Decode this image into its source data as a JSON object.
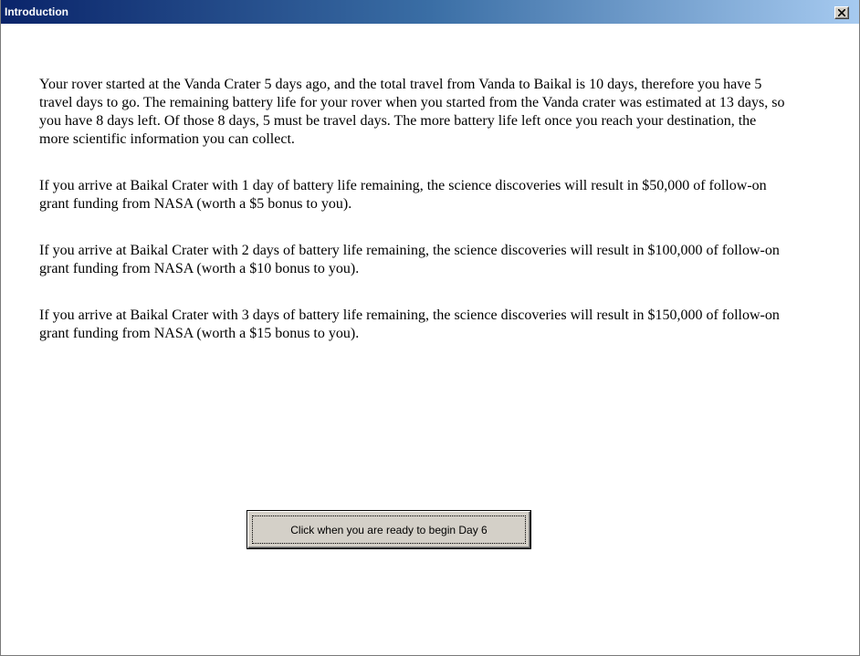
{
  "window": {
    "title": "Introduction",
    "close_icon": "close-icon"
  },
  "paragraphs": [
    "Your rover started at the Vanda Crater 5 days ago, and the total travel from Vanda to Baikal is 10 days, therefore you have 5 travel days to go. The remaining battery life for your rover when you started from the Vanda crater was estimated at 13 days, so you have 8 days left. Of those 8 days, 5 must be travel days. The more battery life left once you reach your destination, the more scientific information you can collect.",
    "If you arrive at Baikal Crater with 1 day of battery life remaining, the science discoveries will result in $50,000 of follow-on grant funding from NASA (worth a $5 bonus to you).",
    "If you arrive at Baikal Crater with 2 days of battery life remaining, the science discoveries will result in $100,000 of follow-on grant funding from NASA (worth a $10 bonus to you).",
    "If you arrive at Baikal Crater with 3 days of battery life remaining, the science discoveries will result in $150,000 of follow-on grant funding from NASA (worth a $15 bonus to you)."
  ],
  "begin_button": {
    "label": "Click when you are ready to begin Day 6"
  },
  "colors": {
    "titlebar_start": "#0a246a",
    "titlebar_end": "#a6caf0",
    "button_face": "#d4d0c8"
  }
}
